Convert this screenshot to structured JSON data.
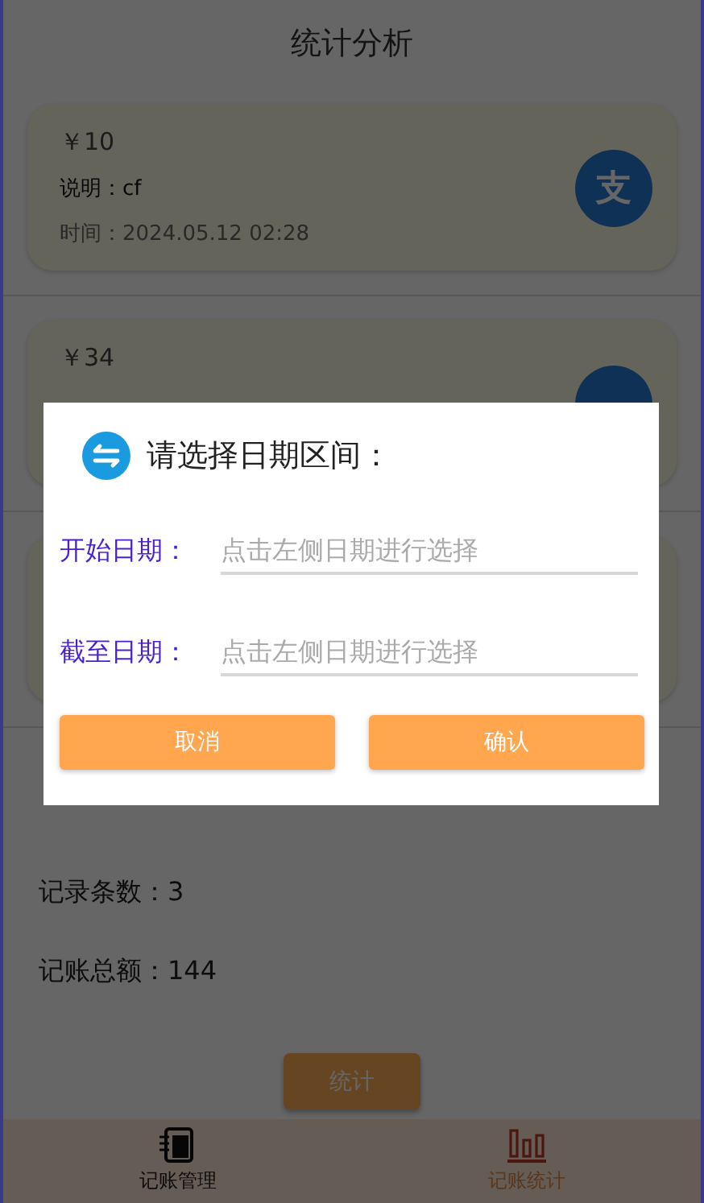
{
  "header": {
    "title": "统计分析"
  },
  "cards": [
    {
      "amount": "￥10",
      "note": "说明：cf",
      "time": "时间：2024.05.12 02:28",
      "badge": "支"
    },
    {
      "amount": "￥34"
    }
  ],
  "stats": [
    "记录条数：3",
    "记账总额：144"
  ],
  "action_button": "统计",
  "bottom_nav": [
    {
      "label": "记账管理",
      "kind": "notebook",
      "selected": false
    },
    {
      "label": "记账统计",
      "kind": "chart",
      "selected": true
    }
  ],
  "dialog": {
    "title": "请选择日期区间：",
    "fields": [
      {
        "label": "开始日期：",
        "placeholder": "点击左侧日期进行选择"
      },
      {
        "label": "截至日期：",
        "placeholder": "点击左侧日期进行选择"
      }
    ],
    "buttons": [
      "取消",
      "确认"
    ]
  }
}
